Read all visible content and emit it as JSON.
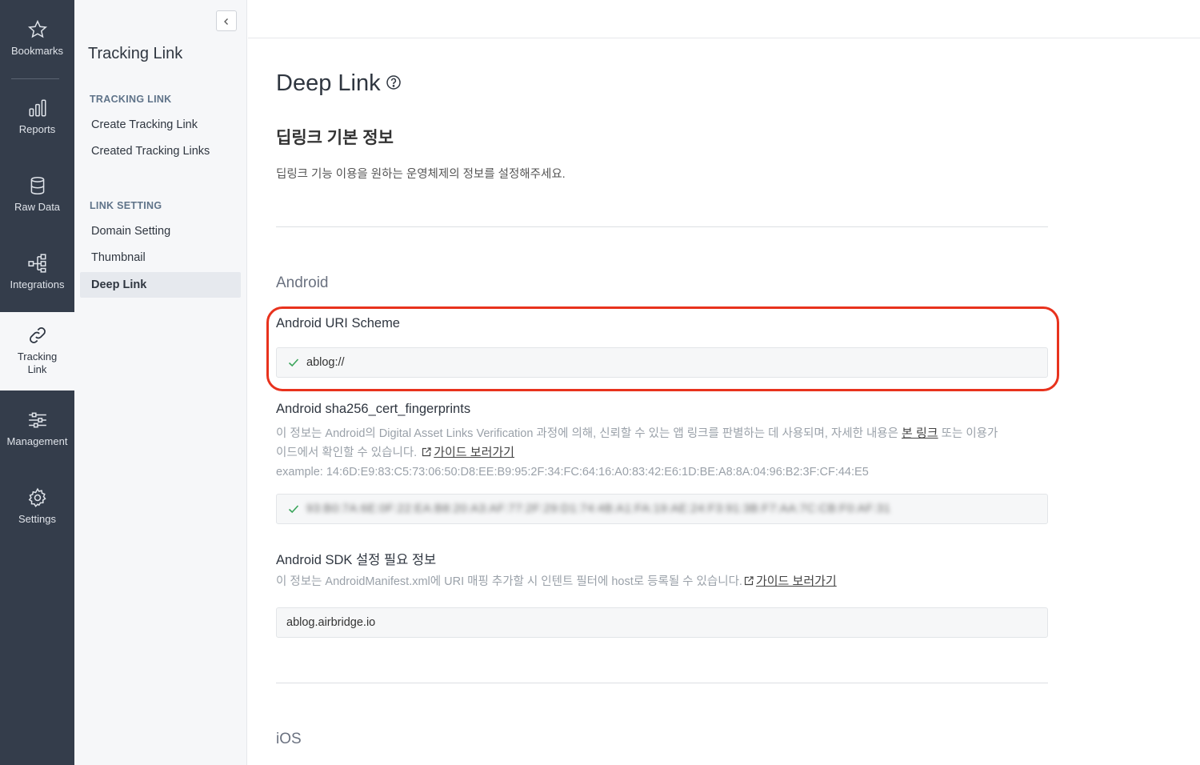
{
  "rail": {
    "items": [
      {
        "label": "Bookmarks",
        "icon": "star-icon"
      },
      {
        "label": "Reports",
        "icon": "bar-chart-icon"
      },
      {
        "label": "Raw Data",
        "icon": "database-icon"
      },
      {
        "label": "Integrations",
        "icon": "integrations-icon"
      },
      {
        "label_line1": "Tracking",
        "label_line2": "Link",
        "icon": "link-icon",
        "active": true
      },
      {
        "label": "Management",
        "icon": "sliders-icon"
      },
      {
        "label": "Settings",
        "icon": "gear-icon"
      }
    ]
  },
  "sidebar": {
    "title": "Tracking Link",
    "sections": [
      {
        "header": "TRACKING LINK",
        "links": [
          "Create Tracking Link",
          "Created Tracking Links"
        ]
      },
      {
        "header": "LINK SETTING",
        "links": [
          "Domain Setting",
          "Thumbnail",
          "Deep Link"
        ]
      }
    ],
    "active_link": "Deep Link"
  },
  "main": {
    "title": "Deep Link",
    "section_title": "딥링크 기본 정보",
    "description": "딥링크 기능 이용을 원하는 운영체제의 정보를 설정해주세요.",
    "android": {
      "label": "Android",
      "uri_scheme": {
        "label": "Android URI Scheme",
        "value": "ablog://"
      },
      "fingerprints": {
        "label": "Android sha256_cert_fingerprints",
        "help_part1": "이 정보는 Android의 Digital Asset Links Verification 과정에 의해, 신뢰할 수 있는 앱 링크를 판별하는 데 사용되며, 자세한 내용은",
        "help_link1": "본 링크",
        "help_part2": "또는 이용가",
        "help_part3": "이드에서 확인할 수 있습니다.",
        "help_link2": "가이드 보러가기",
        "example": "example: 14:6D:E9:83:C5:73:06:50:D8:EE:B9:95:2F:34:FC:64:16:A0:83:42:E6:1D:BE:A8:8A:04:96:B2:3F:CF:44:E5",
        "value": "93:B0:7A:6E:0F:22:EA:B8:20:A3:AF:77:2F:29:D1:74:4B:A1:FA:19:AE:24:F3:91:3B:F7:AA:7C:CB:F0:AF:31"
      },
      "sdk": {
        "label": "Android SDK 설정 필요 정보",
        "help": "이 정보는 AndroidManifest.xml에 URI 매핑 추가할 시 인텐트 필터에 host로 등록될 수 있습니다.",
        "help_link": "가이드 보러가기",
        "value": "ablog.airbridge.io"
      }
    },
    "ios": {
      "label": "iOS"
    }
  },
  "colors": {
    "rail_bg": "#343d4b",
    "highlight": "#e8321d",
    "check": "#3aa55a"
  }
}
